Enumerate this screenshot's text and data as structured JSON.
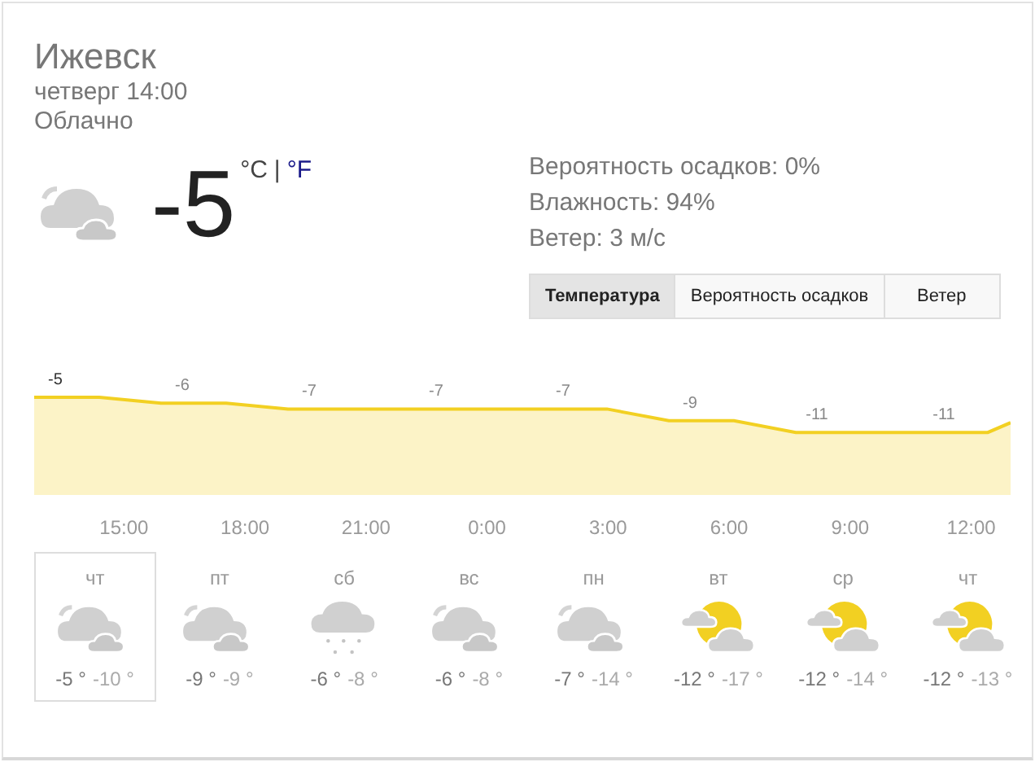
{
  "location": "Ижевск",
  "datetime": "четверг 14:00",
  "condition": "Облачно",
  "current": {
    "temperature": "-5",
    "unit_c": "°C",
    "separator": "|",
    "unit_f": "°F",
    "kind": "cloudy"
  },
  "details": [
    "Вероятность осадков: 0%",
    "Влажность: 94%",
    "Ветер: 3 м/с"
  ],
  "tabs": [
    {
      "label": "Температура",
      "selected": true
    },
    {
      "label": "Вероятность осадков",
      "selected": false
    },
    {
      "label": "Ветер",
      "selected": false
    }
  ],
  "chart": {
    "temperatures": [
      "-5",
      "-6",
      "-7",
      "-7",
      "-7",
      "-9",
      "-11",
      "-11"
    ],
    "times": [
      "15:00",
      "18:00",
      "21:00",
      "0:00",
      "3:00",
      "6:00",
      "9:00",
      "12:00"
    ]
  },
  "days": [
    {
      "day": "чт",
      "kind": "cloudy",
      "high": "-5 °",
      "low": "-10 °",
      "selected": true
    },
    {
      "day": "пт",
      "kind": "cloudy",
      "high": "-9 °",
      "low": "-9 °",
      "selected": false
    },
    {
      "day": "сб",
      "kind": "snow",
      "high": "-6 °",
      "low": "-8 °",
      "selected": false
    },
    {
      "day": "вс",
      "kind": "cloudy",
      "high": "-6 °",
      "low": "-8 °",
      "selected": false
    },
    {
      "day": "пн",
      "kind": "cloudy",
      "high": "-7 °",
      "low": "-14 °",
      "selected": false
    },
    {
      "day": "вт",
      "kind": "partly",
      "high": "-12 °",
      "low": "-17 °",
      "selected": false
    },
    {
      "day": "ср",
      "kind": "partly",
      "high": "-12 °",
      "low": "-14 °",
      "selected": false
    },
    {
      "day": "чт",
      "kind": "partly",
      "high": "-12 °",
      "low": "-13 °",
      "selected": false
    }
  ]
}
